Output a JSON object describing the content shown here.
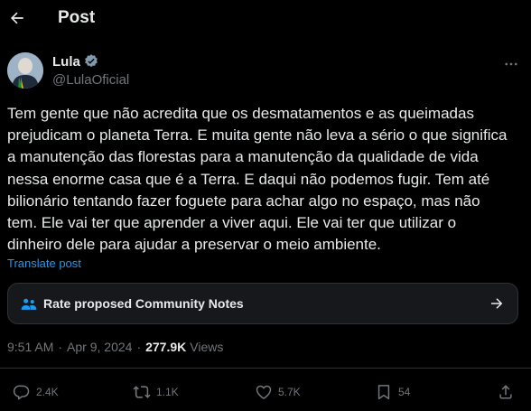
{
  "header": {
    "title": "Post"
  },
  "author": {
    "name": "Lula",
    "handle": "@LulaOficial"
  },
  "tweet": {
    "text": "Tem gente que não acredita que os desmatamentos e as queimadas\nprejudicam o planeta Terra. E muita gente não leva a sério o que significa\na manutenção das florestas para a manutenção da qualidade de vida\nnessa enorme casa que é a Terra. E daqui não podemos fugir. Tem até\nbilionário tentando fazer foguete para achar algo no espaço, mas não\ntem. Ele vai ter que aprender a viver aqui. Ele vai ter que utilizar o\ndinheiro dele para ajudar a preservar o meio ambiente.",
    "translate_label": "Translate post"
  },
  "community_notes": {
    "label": "Rate proposed Community Notes"
  },
  "meta": {
    "time": "9:51 AM",
    "separator": "·",
    "date": "Apr 9, 2024",
    "views_count": "277.9K",
    "views_label": "Views"
  },
  "actions": {
    "replies": "2.4K",
    "reposts": "1.1K",
    "likes": "5.7K",
    "bookmarks": "54"
  },
  "icons": {
    "back": "arrow-left-icon",
    "verified": "verified-badge-icon",
    "more": "more-dots-icon",
    "notes": "community-notes-icon",
    "notes_arrow": "arrow-right-icon",
    "reply": "reply-icon",
    "repost": "repost-icon",
    "like": "heart-icon",
    "bookmark": "bookmark-icon",
    "share": "share-icon"
  },
  "colors": {
    "background": "#000000",
    "text": "#e7e9ea",
    "muted": "#71767b",
    "link": "#1d9bf0",
    "verified": "#829aab",
    "card": "#16181c"
  }
}
